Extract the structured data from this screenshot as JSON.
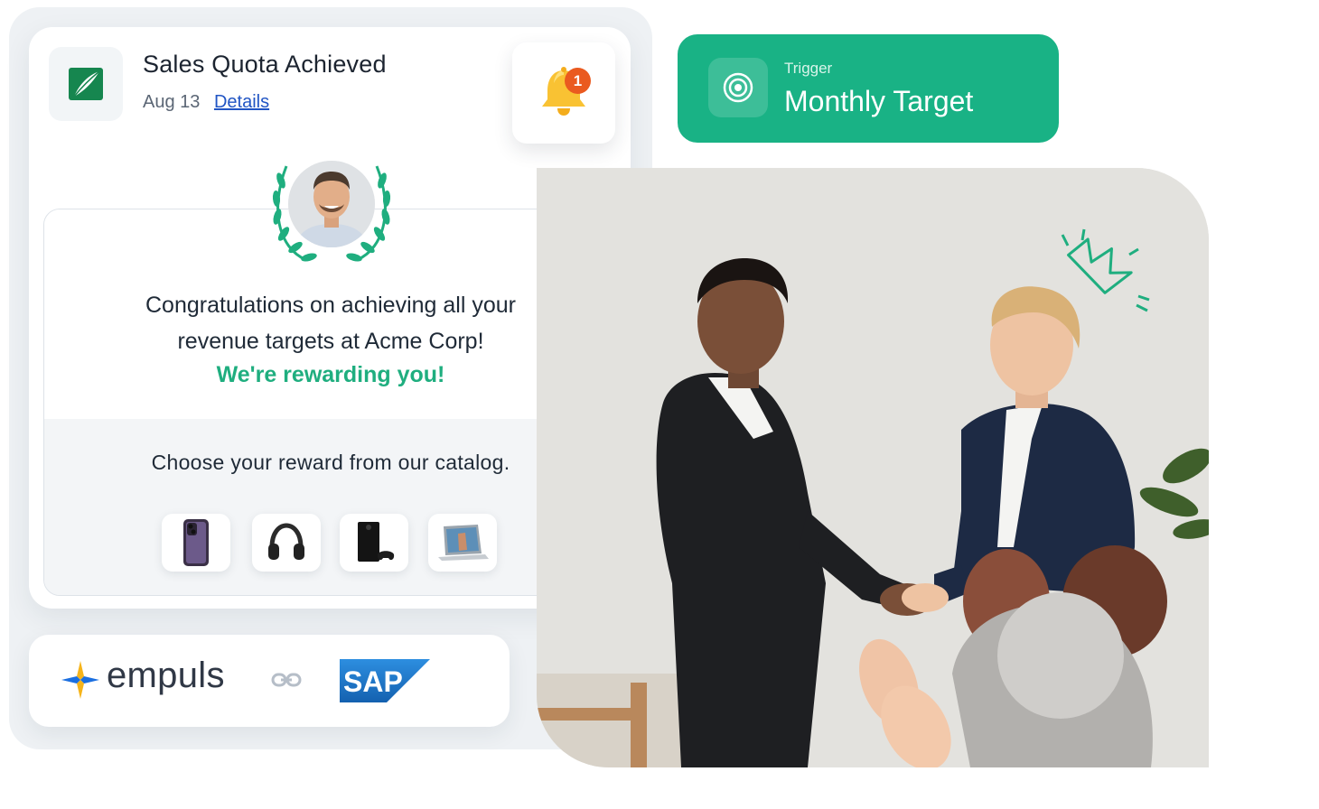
{
  "notification": {
    "title": "Sales Quota Achieved",
    "date": "Aug 13",
    "details_link": "Details",
    "badge_count": "1"
  },
  "message": {
    "line1": "Congratulations on achieving all your",
    "line2": "revenue targets at Acme Corp!",
    "highlight": "We're rewarding you!",
    "catalog_prompt": "Choose your reward from our catalog."
  },
  "rewards": [
    {
      "icon": "smartphone-icon"
    },
    {
      "icon": "headphones-icon"
    },
    {
      "icon": "game-console-icon"
    },
    {
      "icon": "laptop-icon"
    }
  ],
  "integration": {
    "brand": "empuls",
    "partner_logo": "SAP",
    "link_icon": "link-icon"
  },
  "trigger": {
    "label": "Trigger",
    "value": "Monthly Target"
  },
  "colors": {
    "accent": "#19b285",
    "highlight_text": "#1fae7f",
    "link": "#2155c4",
    "badge": "#ea5a1f",
    "sap_blue": "#1b6fc2"
  }
}
